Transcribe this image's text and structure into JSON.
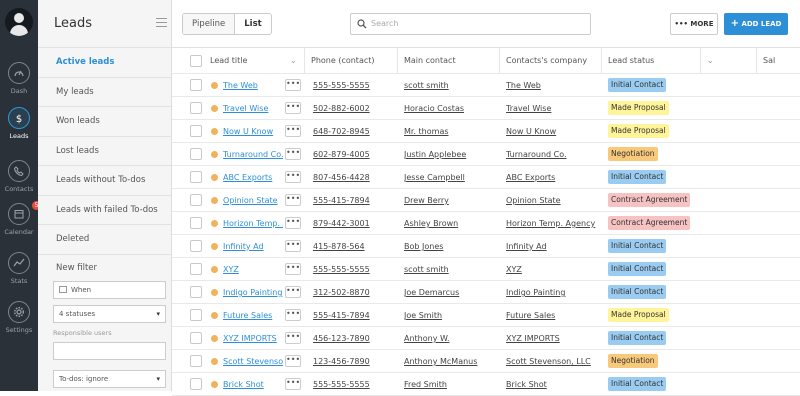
{
  "nav": [
    {
      "label": "Dash",
      "icon": "dashboard-icon"
    },
    {
      "label": "Leads",
      "icon": "dollar-icon",
      "active": true
    },
    {
      "label": "Contacts",
      "icon": "phone-icon"
    },
    {
      "label": "Calendar",
      "icon": "calendar-icon",
      "badge": "5"
    },
    {
      "label": "Stats",
      "icon": "stats-icon"
    },
    {
      "label": "Settings",
      "icon": "gear-icon"
    }
  ],
  "sidebar": {
    "title": "Leads",
    "filters": [
      "Active leads",
      "My leads",
      "Won leads",
      "Lost leads",
      "Leads without To-dos",
      "Leads with failed To-dos",
      "Deleted"
    ],
    "new_filter": "New filter",
    "when_placeholder": "When",
    "statuses": "4 statuses",
    "responsible_label": "Responsible users",
    "todos": "To-dos: ignore"
  },
  "toolbar": {
    "tabs": [
      "Pipeline",
      "List"
    ],
    "active_tab": "List",
    "search_placeholder": "Search",
    "more_label": "MORE",
    "add_label": "ADD LEAD"
  },
  "table": {
    "columns": [
      "Lead title",
      "Phone (contact)",
      "Main contact",
      "Contacts's company",
      "Lead status",
      "Sal"
    ],
    "rows": [
      {
        "title": "The Web",
        "phone": "555-555-5555",
        "contact": "scott smith",
        "company": "The Web",
        "status": "Initial Contact"
      },
      {
        "title": "Travel Wise",
        "phone": "502-882-6002",
        "contact": "Horacio Costas",
        "company": "Travel Wise",
        "status": "Made Proposal"
      },
      {
        "title": "Now U Know",
        "phone": "648-702-8945",
        "contact": "Mr. thomas",
        "company": "Now U Know",
        "status": "Made Proposal"
      },
      {
        "title": "Turnaround Co.",
        "phone": "602-879-4005",
        "contact": "Justin Applebee",
        "company": "Turnaround Co.",
        "status": "Negotiation"
      },
      {
        "title": "ABC Exports",
        "phone": "807-456-4428",
        "contact": "Jesse Campbell",
        "company": "ABC Exports",
        "status": "Initial Contact"
      },
      {
        "title": "Opinion State",
        "phone": "555-415-7894",
        "contact": "Drew Berry",
        "company": "Opinion State",
        "status": "Contract Agreement"
      },
      {
        "title": "Horizon Temp. Ag",
        "phone": "879-442-3001",
        "contact": "Ashley Brown",
        "company": "Horizon Temp. Agency",
        "status": "Contract Agreement"
      },
      {
        "title": "Infinity Ad",
        "phone": "415-878-564",
        "contact": "Bob Jones",
        "company": "Infinity Ad",
        "status": "Initial Contact"
      },
      {
        "title": "XYZ",
        "phone": "555-555-5555",
        "contact": "scott smith",
        "company": "XYZ",
        "status": "Initial Contact"
      },
      {
        "title": "Indigo Painting",
        "phone": "312-502-8870",
        "contact": "Joe Demarcus",
        "company": "Indigo Painting",
        "status": "Initial Contact"
      },
      {
        "title": "Future Sales",
        "phone": "555-415-7894",
        "contact": "Joe Smith",
        "company": "Future Sales",
        "status": "Made Proposal"
      },
      {
        "title": "XYZ IMPORTS",
        "phone": "456-123-7890",
        "contact": "Anthony W.",
        "company": "XYZ IMPORTS",
        "status": "Initial Contact"
      },
      {
        "title": "Scott Stevenson,",
        "phone": "123-456-7890",
        "contact": "Anthony McManus",
        "company": "Scott Stevenson, LLC",
        "status": "Negotiation"
      },
      {
        "title": "Brick Shot",
        "phone": "555-555-5555",
        "contact": "Fred Smith",
        "company": "Brick Shot",
        "status": "Initial Contact"
      }
    ]
  },
  "status_colors": {
    "Initial Contact": "#99ccf0",
    "Made Proposal": "#fff49a",
    "Negotiation": "#f8c97a",
    "Contract Agreement": "#f6c2c2"
  }
}
